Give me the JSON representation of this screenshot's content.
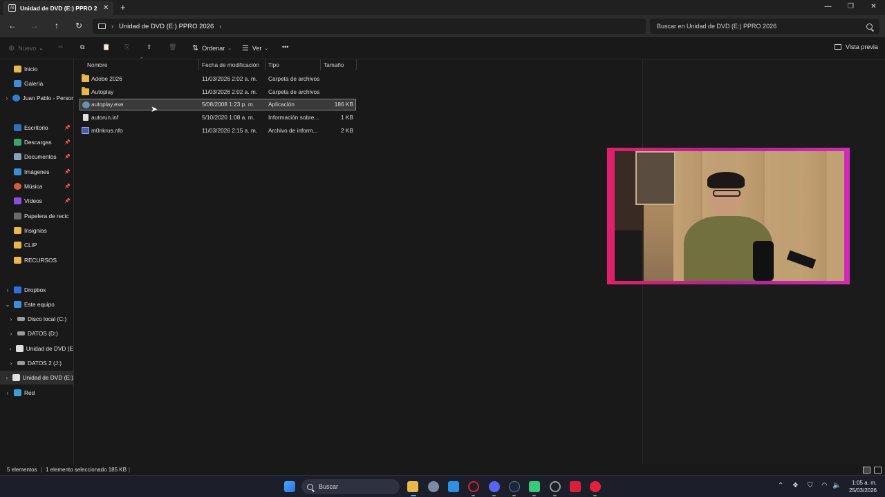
{
  "window": {
    "tab_title": "Unidad de DVD (E:) PPRO 202",
    "tab_close": "✕",
    "new_tab": "+",
    "controls": [
      "—",
      "❐",
      "✕"
    ]
  },
  "nav": {
    "back": "←",
    "forward": "→",
    "up": "↑",
    "refresh": "↻",
    "breadcrumb": "Unidad de DVD (E:) PPRO 2026",
    "search_placeholder": "Buscar en Unidad de DVD (E:) PPRO 2026"
  },
  "commands": {
    "new": "Nuevo",
    "sort": "Ordenar",
    "view": "Ver",
    "more": "•••",
    "preview": "Vista previa",
    "icons": {
      "cut": "✂",
      "copy": "⧉",
      "paste": "📋",
      "rename": "⎘",
      "share": "⇪",
      "delete": "🗑"
    }
  },
  "sidebar": {
    "items": [
      {
        "label": "Inicio",
        "icon": "home-icon",
        "color": "#e8b84a"
      },
      {
        "label": "Galería",
        "icon": "gallery-icon",
        "color": "#3a8fd8"
      },
      {
        "label": "Juan Pablo - Persor",
        "icon": "onedrive-icon",
        "color": "#2f7fd0"
      },
      {
        "label": "Escritorio",
        "icon": "desktop-icon",
        "color": "#2e6fc0"
      },
      {
        "label": "Descargas",
        "icon": "downloads-icon",
        "color": "#3aa56a"
      },
      {
        "label": "Documentos",
        "icon": "documents-icon",
        "color": "#8aa0b8"
      },
      {
        "label": "Imágenes",
        "icon": "pictures-icon",
        "color": "#3a8fd8"
      },
      {
        "label": "Música",
        "icon": "music-icon",
        "color": "#d85a3a"
      },
      {
        "label": "Vídeos",
        "icon": "videos-icon",
        "color": "#8a4fd8"
      },
      {
        "label": "Papelera de recic",
        "icon": "recycle-bin-icon",
        "color": "#6a6a6a"
      },
      {
        "label": "Insignias",
        "icon": "folder-icon",
        "color": "#e8b84a"
      },
      {
        "label": "CLIP",
        "icon": "folder-icon",
        "color": "#e8b84a"
      },
      {
        "label": "RECURSOS",
        "icon": "folder-icon",
        "color": "#e8b84a"
      },
      {
        "label": "Dropbox",
        "icon": "dropbox-icon",
        "color": "#2f6fe0"
      },
      {
        "label": "Este equipo",
        "icon": "pc-icon",
        "color": "#3a8fd8"
      },
      {
        "label": "Disco local (C:)",
        "icon": "drive-icon",
        "color": "#9a9a9a"
      },
      {
        "label": "DATOS (D:)",
        "icon": "drive-icon",
        "color": "#9a9a9a"
      },
      {
        "label": "Unidad de DVD (E",
        "icon": "dvd-icon",
        "color": "#e0e0e0"
      },
      {
        "label": "DATOS 2  (J:)",
        "icon": "drive-icon",
        "color": "#9a9a9a"
      },
      {
        "label": "Unidad de DVD (E:)",
        "icon": "dvd-icon",
        "color": "#e0e0e0"
      },
      {
        "label": "Red",
        "icon": "network-icon",
        "color": "#3a9fd8"
      }
    ]
  },
  "columns": {
    "name": "Nombre",
    "modified": "Fecha de modificación",
    "type": "Tipo",
    "size": "Tamaño"
  },
  "files": [
    {
      "name": "Adobe 2026",
      "modified": "11/03/2026 2:02 a. m.",
      "type": "Carpeta de archivos",
      "size": "",
      "icon": "folder-icon"
    },
    {
      "name": "Autoplay",
      "modified": "11/03/2026 2:02 a. m.",
      "type": "Carpeta de archivos",
      "size": "",
      "icon": "folder-icon"
    },
    {
      "name": "autoplay.exe",
      "modified": "5/08/2008 1:23 p. m.",
      "type": "Aplicación",
      "size": "186 KB",
      "icon": "exe-icon"
    },
    {
      "name": "autorun.inf",
      "modified": "5/10/2020 1:08 a. m.",
      "type": "Información sobre...",
      "size": "1 KB",
      "icon": "inf-file-icon"
    },
    {
      "name": "m0nkrus.nfo",
      "modified": "11/03/2026 2:15 a. m.",
      "type": "Archivo de inform...",
      "size": "2 KB",
      "icon": "nfo-file-icon"
    }
  ],
  "status": {
    "count": "5 elementos",
    "selection": "1 elemento seleccionado  185 KB",
    "sep": "|"
  },
  "taskbar": {
    "search_label": "Buscar",
    "time": "1:05 a. m.",
    "date": "25/03/2026",
    "apps": [
      {
        "name": "start-icon",
        "color": "#3a8fe8"
      },
      {
        "name": "file-explorer-icon",
        "color": "#e8b84a"
      },
      {
        "name": "settings-icon",
        "color": "#7a8aa8"
      },
      {
        "name": "store-icon",
        "color": "#2f8fe0"
      },
      {
        "name": "opera-icon",
        "color": "#d8203a"
      },
      {
        "name": "discord-icon",
        "color": "#5865f2"
      },
      {
        "name": "steam-icon",
        "color": "#1b2838"
      },
      {
        "name": "chat-icon",
        "color": "#3ac87a"
      },
      {
        "name": "chrome-icon",
        "color": "#9a9a9a"
      },
      {
        "name": "video-editor-icon",
        "color": "#d8203a"
      },
      {
        "name": "youtube-icon",
        "color": "#e8203a"
      }
    ]
  }
}
